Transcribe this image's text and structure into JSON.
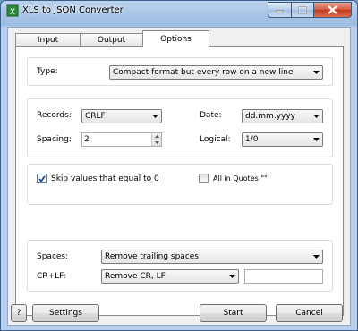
{
  "window": {
    "title": "XLS to JSON Converter"
  },
  "tabs": [
    {
      "label": "Input"
    },
    {
      "label": "Output"
    },
    {
      "label": "Options"
    }
  ],
  "options": {
    "type_label": "Type:",
    "type_value": "Compact format but every row on a new line",
    "records_label": "Records:",
    "records_value": "CRLF",
    "date_label": "Date:",
    "date_value": "dd.mm.yyyy",
    "spacing_label": "Spacing:",
    "spacing_value": "2",
    "logical_label": "Logical:",
    "logical_value": "1/0",
    "skip_zero_label": "Skip values that equal to 0",
    "skip_zero_checked": true,
    "all_quotes_label": "All in Quotes \"\"",
    "all_quotes_checked": false,
    "spaces_label": "Spaces:",
    "spaces_value": "Remove trailing spaces",
    "crlf_label": "CR+LF:",
    "crlf_value": "Remove CR, LF",
    "crlf_replacement": ""
  },
  "footer": {
    "help_label": "?",
    "settings_label": "Settings",
    "start_label": "Start",
    "cancel_label": "Cancel"
  }
}
